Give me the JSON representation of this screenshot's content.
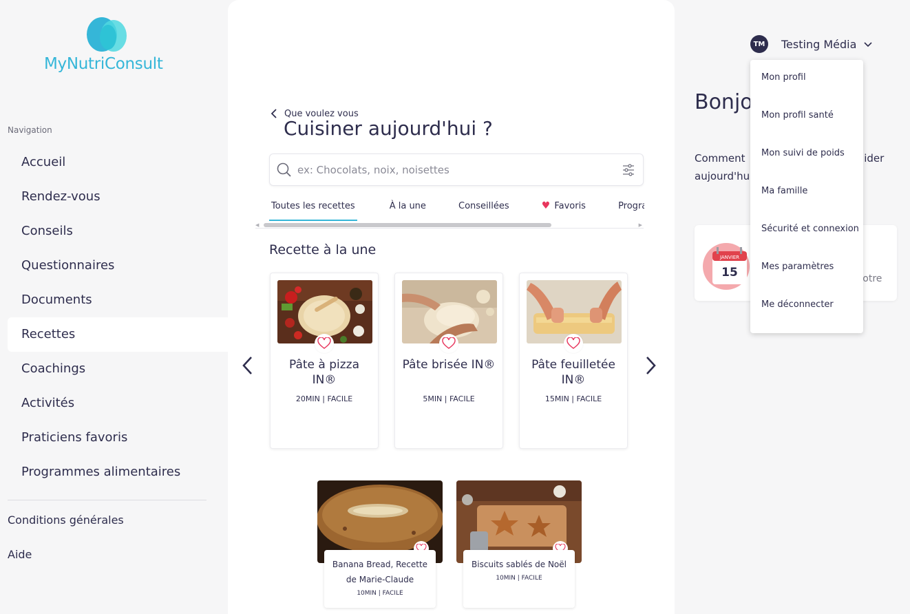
{
  "brand": {
    "name": "MyNutriConsult",
    "color": "#35b6d8"
  },
  "sidebar": {
    "heading": "Navigation",
    "items": [
      {
        "label": "Accueil"
      },
      {
        "label": "Rendez-vous"
      },
      {
        "label": "Conseils"
      },
      {
        "label": "Questionnaires"
      },
      {
        "label": "Documents"
      },
      {
        "label": "Recettes",
        "active": true
      },
      {
        "label": "Coachings"
      },
      {
        "label": "Activités"
      },
      {
        "label": "Praticiens favoris"
      },
      {
        "label": "Programmes alimentaires"
      }
    ],
    "footer": [
      {
        "label": "Conditions générales"
      },
      {
        "label": "Aide"
      }
    ]
  },
  "main": {
    "subtitle": "Que voulez vous",
    "title": "Cuisiner aujourd'hui ?",
    "search": {
      "placeholder": "ex: Chocolats, noix, noisettes",
      "value": ""
    },
    "tabs": [
      {
        "label": "Toutes les recettes",
        "active": true
      },
      {
        "label": "À la une"
      },
      {
        "label": "Conseillées"
      },
      {
        "label": "Favoris",
        "icon": "heart-icon"
      },
      {
        "label": "Programmes"
      }
    ],
    "featured_title": "Recette à la une",
    "featured": [
      {
        "name": "Pâte à pizza IN®",
        "meta": "20MIN | FACILE"
      },
      {
        "name": "Pâte brisée IN®",
        "meta": "5MIN | FACILE"
      },
      {
        "name": "Pâte feuilletée IN®",
        "meta": "15MIN | FACILE"
      }
    ],
    "recipes": [
      {
        "name": "Banana Bread, Recette de Marie-Claude",
        "meta": "10MIN | FACILE"
      },
      {
        "name": "Biscuits sablés de Noël",
        "meta": "10MIN | FACILE"
      }
    ]
  },
  "right": {
    "greeting": "Bonjour Média",
    "help_start": "Comment",
    "help_cont": "aujourd'hui",
    "help_end": "aider",
    "rdv_text": "votre",
    "calendar_month": "JANVIER",
    "calendar_day": "15",
    "user": {
      "initials": "TM",
      "name": "Testing Média"
    },
    "menu": [
      {
        "label": "Mon profil"
      },
      {
        "label": "Mon profil santé"
      },
      {
        "label": "Mon suivi de poids"
      },
      {
        "label": "Ma famille"
      },
      {
        "label": "Sécurité et connexion"
      },
      {
        "label": "Mes paramètres"
      },
      {
        "label": "Me déconnecter"
      }
    ]
  },
  "colors": {
    "accent": "#35b6d8",
    "text": "#2e2d4d",
    "heart": "#e8365d",
    "avatar": "#2e2d4d"
  }
}
